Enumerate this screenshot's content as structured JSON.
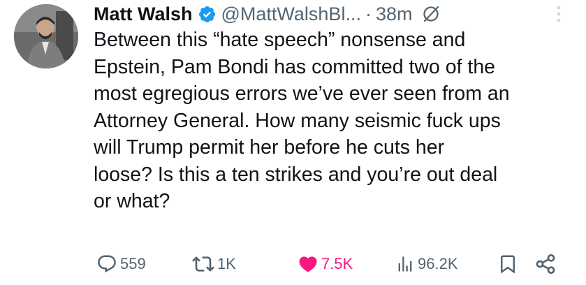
{
  "author": {
    "name": "Matt Walsh",
    "handle": "@MattWalshBl...",
    "separator": "·",
    "time": "38m"
  },
  "tweet": {
    "lines": [
      "Between this “hate speech” nonsense and",
      "Epstein, Pam Bondi has committed two of the",
      "most egregious errors we’ve ever seen from an",
      "Attorney General. How many seismic fuck ups",
      "will Trump permit her before he cuts her",
      "loose? Is this a ten strikes and you’re out deal",
      "or what?"
    ]
  },
  "actions": {
    "replies": "559",
    "reposts": "1K",
    "likes": "7.5K",
    "views": "96.2K"
  },
  "colors": {
    "text": "#0f1419",
    "secondary": "#536471",
    "like": "#f91880",
    "verified": "#1d9bf0"
  },
  "icons": {
    "verified": "verified-badge-icon",
    "grok": "grok-icon",
    "more": "more-vertical-icon",
    "reply": "reply-bubble-icon",
    "repost": "repost-icon",
    "like": "heart-filled-icon",
    "views": "views-bar-chart-icon",
    "bookmark": "bookmark-icon",
    "share": "share-icon"
  }
}
